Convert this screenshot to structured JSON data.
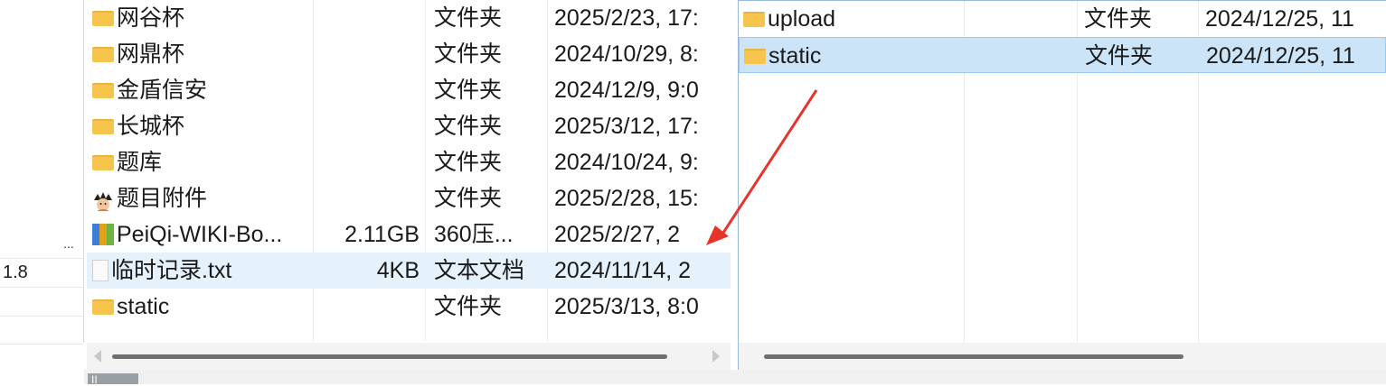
{
  "left_strip": {
    "rows": [
      {
        "text": "",
        "has_button": true,
        "button_label": "..."
      },
      {
        "text": "1.8",
        "has_button": false
      }
    ]
  },
  "left_pane": {
    "files": [
      {
        "name": "网谷杯",
        "size": "",
        "type": "文件夹",
        "modified": "2025/2/23, 17:",
        "icon": "folder-icon"
      },
      {
        "name": "网鼎杯",
        "size": "",
        "type": "文件夹",
        "modified": "2024/10/29, 8:",
        "icon": "folder-icon"
      },
      {
        "name": "金盾信安",
        "size": "",
        "type": "文件夹",
        "modified": "2024/12/9, 9:0",
        "icon": "folder-icon"
      },
      {
        "name": "长城杯",
        "size": "",
        "type": "文件夹",
        "modified": "2025/3/12, 17:",
        "icon": "folder-icon"
      },
      {
        "name": "题库",
        "size": "",
        "type": "文件夹",
        "modified": "2024/10/24, 9:",
        "icon": "folder-icon"
      },
      {
        "name": "题目附件",
        "size": "",
        "type": "文件夹",
        "modified": "2025/2/28, 15:",
        "icon": "avatar-icon"
      },
      {
        "name": "PeiQi-WIKI-Bo...",
        "size": "2.11GB",
        "type": "360压...",
        "modified": "2025/2/27, 2",
        "icon": "archive-icon"
      },
      {
        "name": "临时记录.txt",
        "size": "4KB",
        "type": "文本文档",
        "modified": "2024/11/14, 2",
        "icon": "txt-file-icon"
      },
      {
        "name": "static",
        "size": "",
        "type": "文件夹",
        "modified": "2025/3/13, 8:0",
        "icon": "folder-icon"
      }
    ]
  },
  "right_pane": {
    "files": [
      {
        "name": "upload",
        "type": "文件夹",
        "modified": "2024/12/25, 11",
        "icon": "folder-icon"
      },
      {
        "name": "static",
        "type": "文件夹",
        "modified": "2024/12/25, 11",
        "icon": "folder-icon"
      }
    ]
  },
  "status_bar": {
    "chip": "II"
  },
  "colors": {
    "selected_row": "#cce4f7",
    "hover_row": "#e5f1fb",
    "folder": "#f5c54e",
    "annotation_arrow": "#e8332a"
  }
}
